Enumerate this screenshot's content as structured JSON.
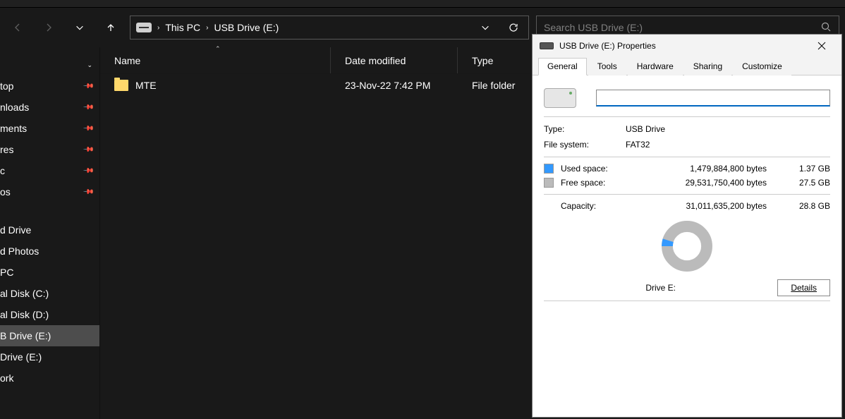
{
  "address": {
    "this_pc": "This PC",
    "drive": "USB Drive (E:)"
  },
  "search": {
    "placeholder": "Search USB Drive (E:)"
  },
  "sidebar": {
    "pinned": [
      "top",
      "nloads",
      "ments",
      "res",
      "c",
      "os"
    ],
    "drives": [
      "d Drive",
      "d Photos",
      "PC",
      "al Disk (C:)",
      "al Disk (D:)",
      "B Drive (E:)",
      "Drive (E:)",
      "ork"
    ],
    "selected_index": 5
  },
  "columns": {
    "name": "Name",
    "date": "Date modified",
    "type": "Type"
  },
  "files": [
    {
      "name": "MTE",
      "date": "23-Nov-22 7:42 PM",
      "type": "File folder"
    }
  ],
  "properties": {
    "title": "USB Drive (E:) Properties",
    "tabs": [
      "General",
      "Tools",
      "Hardware",
      "Sharing",
      "Customize"
    ],
    "active_tab": 0,
    "label_value": "",
    "type_label": "Type:",
    "type_value": "USB Drive",
    "fs_label": "File system:",
    "fs_value": "FAT32",
    "used_label": "Used space:",
    "used_bytes": "1,479,884,800 bytes",
    "used_h": "1.37 GB",
    "free_label": "Free space:",
    "free_bytes": "29,531,750,400 bytes",
    "free_h": "27.5 GB",
    "capacity_label": "Capacity:",
    "capacity_bytes": "31,011,635,200 bytes",
    "capacity_h": "28.8 GB",
    "drive_caption": "Drive E:",
    "details_btn": "Details",
    "used_pct": 4.77
  },
  "colors": {
    "used": "#3399ff",
    "free": "#bbbbbb"
  },
  "chart_data": {
    "type": "pie",
    "title": "Drive E: space usage",
    "series": [
      {
        "name": "Used space",
        "value_bytes": 1479884800,
        "value_h": "1.37 GB",
        "color": "#3399ff"
      },
      {
        "name": "Free space",
        "value_bytes": 29531750400,
        "value_h": "27.5 GB",
        "color": "#bbbbbb"
      }
    ],
    "total_bytes": 31011635200,
    "total_h": "28.8 GB"
  }
}
